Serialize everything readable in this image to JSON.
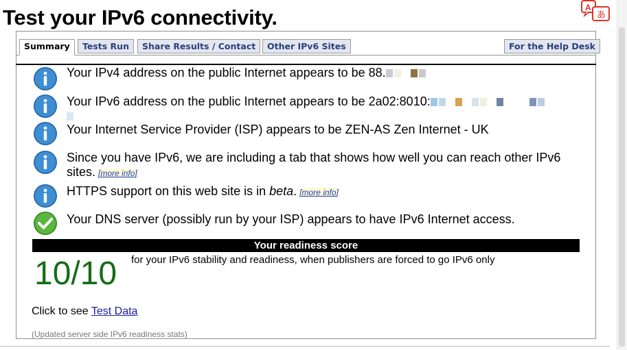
{
  "page": {
    "title": "Test your IPv6 connectivity."
  },
  "tabs": [
    {
      "label": "Summary",
      "active": true
    },
    {
      "label": "Tests Run"
    },
    {
      "label": "Share Results / Contact"
    },
    {
      "label": "Other IPv6 Sites"
    },
    {
      "label": "For the Help Desk"
    }
  ],
  "messages": {
    "ipv4_prefix": "Your IPv4 address on the public Internet appears to be 88.",
    "ipv6_prefix": "Your IPv6 address on the public Internet appears to be 2a02:8010:",
    "isp": "Your Internet Service Provider (ISP) appears to be ZEN-AS Zen Internet - UK",
    "ipv6_tab": "Since you have IPv6, we are including a tab that shows how well you can reach other IPv6 sites.",
    "https_prefix": "HTTPS support on this web site is in ",
    "https_beta": "beta",
    "https_suffix": ".",
    "dns": "Your DNS server (possibly run by your ISP) appears to have IPv6 Internet access."
  },
  "links": {
    "more_info": "[more info]"
  },
  "score": {
    "heading": "Your readiness score",
    "value": "10/10",
    "description": "for your IPv6 stability and readiness, when publishers are forced to go IPv6 only"
  },
  "footer": {
    "click_prefix": "Click to see ",
    "test_data_link": "Test Data",
    "updated": "(Updated server side IPv6 readiness stats)"
  },
  "colors": {
    "info_icon": "#3e8ed6",
    "success_icon": "#5ab63f",
    "score_value": "#166d16",
    "tab_bg": "#e3e6ee",
    "tab_text": "#27407e"
  },
  "icons": {
    "info": "info-icon",
    "success": "checkmark-icon",
    "translate": "translate-icon"
  }
}
